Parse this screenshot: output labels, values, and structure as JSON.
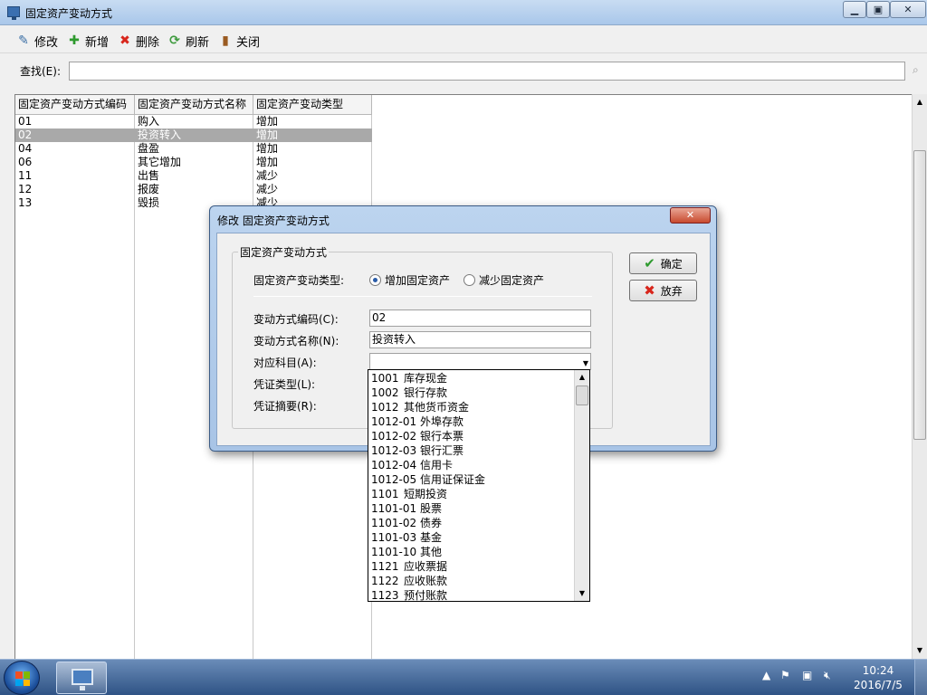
{
  "window": {
    "title": "固定资产变动方式"
  },
  "toolbar": {
    "edit": "修改",
    "add": "新增",
    "delete": "删除",
    "refresh": "刷新",
    "close": "关闭"
  },
  "search": {
    "label": "查找(E):",
    "value": ""
  },
  "grid": {
    "columns": [
      "固定资产变动方式编码",
      "固定资产变动方式名称",
      "固定资产变动类型"
    ],
    "rows": [
      [
        "01",
        "购入",
        "增加"
      ],
      [
        "02",
        "投资转入",
        "增加"
      ],
      [
        "04",
        "盘盈",
        "增加"
      ],
      [
        "06",
        "其它增加",
        "增加"
      ],
      [
        "11",
        "出售",
        "减少"
      ],
      [
        "12",
        "报废",
        "减少"
      ],
      [
        "13",
        "毁损",
        "减少"
      ]
    ],
    "selected_index": 1
  },
  "dialog": {
    "title": "修改 固定资产变动方式",
    "group_label": "固定资产变动方式",
    "type_label": "固定资产变动类型:",
    "radio_increase": "增加固定资产",
    "radio_decrease": "减少固定资产",
    "selected_type": "increase",
    "code_label": "变动方式编码(C):",
    "code_value": "02",
    "name_label": "变动方式名称(N):",
    "name_value": "投资转入",
    "account_label": "对应科目(A):",
    "account_value": "",
    "voucher_type_label": "凭证类型(L):",
    "voucher_summary_label": "凭证摘要(R):",
    "ok_label": "确定",
    "cancel_label": "放弃"
  },
  "dropdown": {
    "items": [
      [
        "1001",
        "库存现金"
      ],
      [
        "1002",
        "银行存款"
      ],
      [
        "1012",
        "其他货币资金"
      ],
      [
        "1012-01",
        "外埠存款"
      ],
      [
        "1012-02",
        "银行本票"
      ],
      [
        "1012-03",
        "银行汇票"
      ],
      [
        "1012-04",
        "信用卡"
      ],
      [
        "1012-05",
        "信用证保证金"
      ],
      [
        "1101",
        "短期投资"
      ],
      [
        "1101-01",
        "股票"
      ],
      [
        "1101-02",
        "债券"
      ],
      [
        "1101-03",
        "基金"
      ],
      [
        "1101-10",
        "其他"
      ],
      [
        "1121",
        "应收票据"
      ],
      [
        "1122",
        "应收账款"
      ],
      [
        "1123",
        "预付账款"
      ]
    ]
  },
  "taskbar": {
    "time": "10:24",
    "date": "2016/7/5"
  },
  "colors": {
    "selected_row": "#a9a9a9",
    "dialog_frame": "#bcd4ef",
    "taskbar": "#2f5385"
  }
}
